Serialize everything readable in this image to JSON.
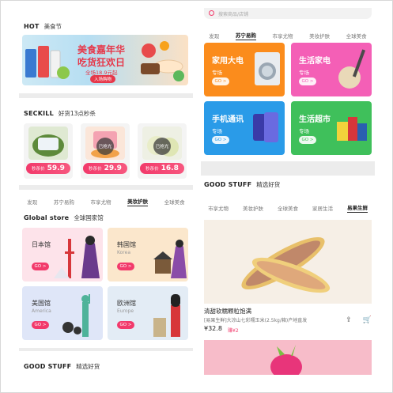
{
  "hot": {
    "title_en": "HOT",
    "title_cn": "美食节",
    "banner_line1": "美食嘉年华",
    "banner_line2": "吃货狂欢日",
    "banner_line3": "全场18.9元起",
    "banner_button": "入场购物"
  },
  "seckill": {
    "title_en": "SECKILL",
    "title_cn": "好货13点秒杀",
    "items": [
      {
        "label": "秒杀价",
        "price": "59.9",
        "badge": ""
      },
      {
        "label": "秒杀价",
        "price": "29.9",
        "badge": "已抢光"
      },
      {
        "label": "秒杀价",
        "price": "16.8",
        "badge": "已抢光"
      }
    ]
  },
  "left_tabs": [
    "发现",
    "苏宁易购",
    "市享尤物",
    "美妆护肤",
    "全球美食"
  ],
  "left_tabs_active": "美妆护肤",
  "global": {
    "title_en": "Global store",
    "title_cn": "全球国家馆",
    "countries": [
      {
        "cn": "日本馆",
        "en": "",
        "go": "GO >"
      },
      {
        "cn": "韩国馆",
        "en": "Korea",
        "go": "GO >"
      },
      {
        "cn": "美国馆",
        "en": "America",
        "go": "GO >"
      },
      {
        "cn": "欧洲馆",
        "en": "Europe",
        "go": "GO >"
      }
    ]
  },
  "good_stuff": {
    "title_en": "GOOD STUFF",
    "title_cn": "精选好货"
  },
  "right": {
    "search_placeholder": "搜索商品/店铺",
    "tabs": [
      "发现",
      "苏宁易购",
      "市享尤物",
      "美妆护肤",
      "全球美食"
    ],
    "tabs_active": "苏宁易购",
    "categories": [
      {
        "title": "家用大电",
        "sub": "专场",
        "go": "GO >",
        "color": "#fb8c1c"
      },
      {
        "title": "生活家电",
        "sub": "专场",
        "go": "GO >",
        "color": "#f45fb6"
      },
      {
        "title": "手机通讯",
        "sub": "专场",
        "go": "GO >",
        "color": "#2a9be8"
      },
      {
        "title": "生活超市",
        "sub": "专场",
        "go": "GO >",
        "color": "#3fc05b"
      }
    ],
    "good_stuff_en": "GOOD STUFF",
    "good_stuff_cn": "精选好货",
    "tabs2": [
      "市享尤物",
      "美妆护肤",
      "全球美食",
      "家居生活",
      "易果生鲜"
    ],
    "tabs2_active": "易果生鲜",
    "product": {
      "name": "清甜软糯颗粒饱满",
      "desc": "[易果生鲜]大凉山七彩糯玉米(2.5kg/箱)产地直发",
      "price": "¥32.8",
      "save": "赚¥2"
    }
  }
}
